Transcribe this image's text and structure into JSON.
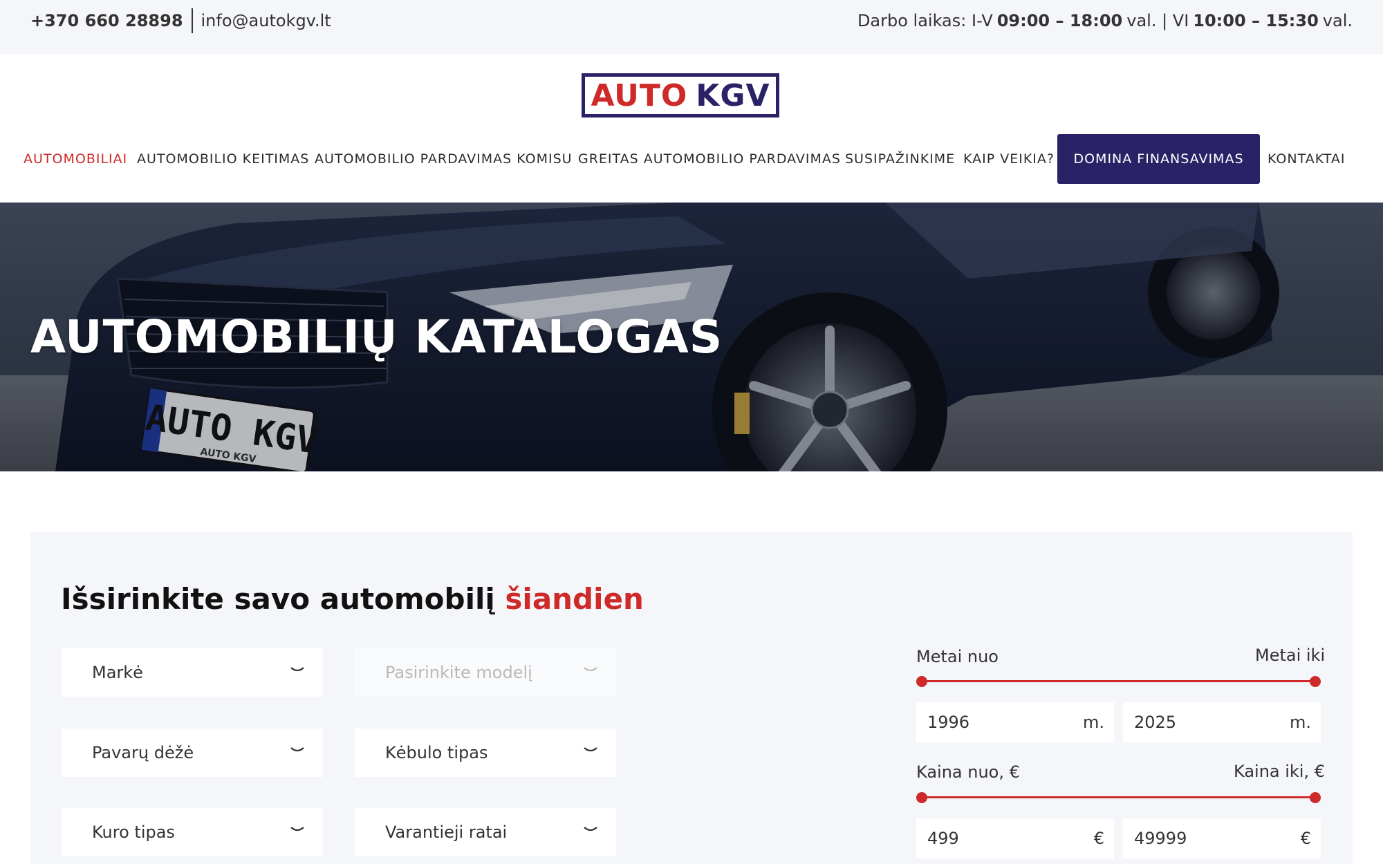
{
  "topbar": {
    "phone": "+370 660 28898",
    "email": "info@autokgv.lt",
    "hours_prefix": "Darbo laikas: I-V",
    "hours_weekday": "09:00 – 18:00",
    "hours_mid": "val. | VI",
    "hours_saturday": "10:00 – 15:30",
    "hours_suffix": "val."
  },
  "logo": {
    "part1": "AUTO",
    "part2": "KGV"
  },
  "nav": {
    "items": [
      {
        "label": "AUTOMOBILIAI"
      },
      {
        "label": "AUTOMOBILIO KEITIMAS"
      },
      {
        "label": "AUTOMOBILIO PARDAVIMAS KOMISU"
      },
      {
        "label": "GREITAS AUTOMOBILIO PARDAVIMAS"
      },
      {
        "label": "SUSIPAŽINKIME"
      },
      {
        "label": "KAIP VEIKIA?"
      },
      {
        "label": "DOMINA FINANSAVIMAS"
      },
      {
        "label": "KONTAKTAI"
      }
    ]
  },
  "hero": {
    "title": "AUTOMOBILIŲ KATALOGAS",
    "plate_text": "AUTO KGV",
    "plate_small": "AUTO KGV"
  },
  "filter": {
    "title_main": "Išsirinkite savo automobilį",
    "title_accent": "šiandien",
    "selects": {
      "make": "Markė",
      "model": "Pasirinkite modelį",
      "gearbox": "Pavarų dėžė",
      "body": "Kėbulo tipas",
      "fuel": "Kuro tipas",
      "drive": "Varantieji ratai"
    },
    "year": {
      "from_label": "Metai nuo",
      "to_label": "Metai iki",
      "from_value": "1996",
      "to_value": "2025",
      "unit": "m."
    },
    "price": {
      "from_label": "Kaina nuo, €",
      "to_label": "Kaina iki, €",
      "from_value": "499",
      "to_value": "49999",
      "unit": "€"
    }
  },
  "colors": {
    "accent_red": "#cf2a2a",
    "brand_navy": "#2a2266",
    "panel_bg": "#f4f6f9"
  }
}
